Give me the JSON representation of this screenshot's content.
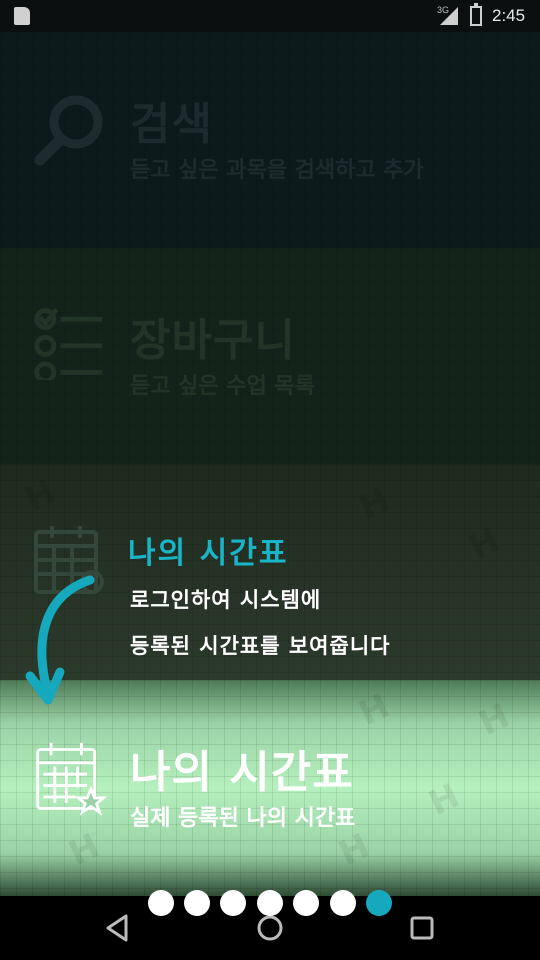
{
  "status_bar": {
    "time": "2:45",
    "network": "3G"
  },
  "menu_items": [
    {
      "icon": "search-icon",
      "title": "검색",
      "subtitle": "듣고 싶은 과목을 검색하고 추가"
    },
    {
      "icon": "checklist-icon",
      "title": "장바구니",
      "subtitle": "듣고 싶은 수업 목록"
    },
    {
      "icon": "calendar-icon",
      "title": "",
      "subtitle": ""
    },
    {
      "icon": "calendar-star-icon",
      "title": "나의 시간표",
      "subtitle": "실제 등록된 나의 시간표"
    }
  ],
  "tutorial": {
    "title": "나의 시간표",
    "line1": "로그인하여 시스템에",
    "line2": "등록된 시간표를 보여줍니다"
  },
  "pager": {
    "total": 7,
    "active": 7
  },
  "colors": {
    "accent": "#16a9bd",
    "highlight_bg": "#b6f0be"
  }
}
